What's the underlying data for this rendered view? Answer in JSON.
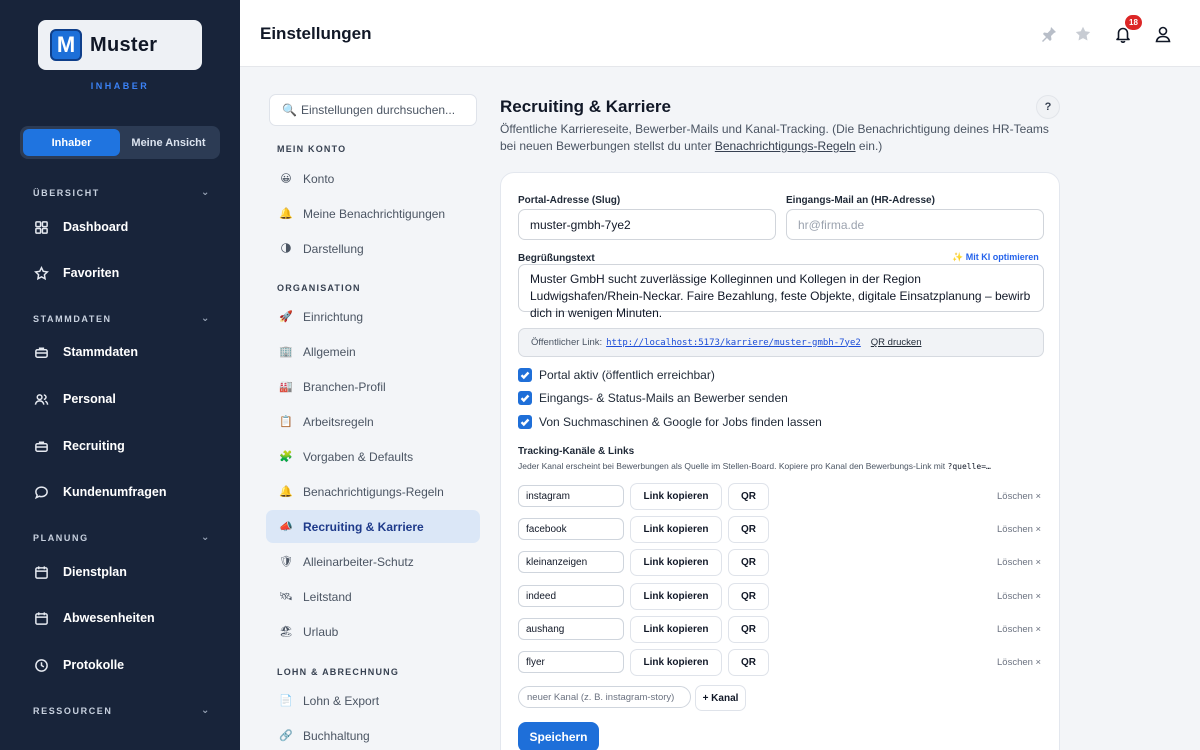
{
  "brand": {
    "logo_letter": "M",
    "name": "Muster",
    "role": "INHABER"
  },
  "view_toggle": {
    "owner": "Inhaber",
    "my_view": "Meine Ansicht"
  },
  "sidebar": {
    "sections": [
      {
        "title": "ÜBERSICHT",
        "items": [
          {
            "label": "Dashboard",
            "icon": "grid-icon"
          },
          {
            "label": "Favoriten",
            "icon": "star-icon"
          }
        ]
      },
      {
        "title": "STAMMDATEN",
        "items": [
          {
            "label": "Stammdaten",
            "icon": "briefcase-icon"
          },
          {
            "label": "Personal",
            "icon": "users-icon"
          },
          {
            "label": "Recruiting",
            "icon": "briefcase-icon"
          },
          {
            "label": "Kundenumfragen",
            "icon": "chat-icon"
          }
        ]
      },
      {
        "title": "PLANUNG",
        "items": [
          {
            "label": "Dienstplan",
            "icon": "calendar-icon"
          },
          {
            "label": "Abwesenheiten",
            "icon": "calendar-icon"
          },
          {
            "label": "Protokolle",
            "icon": "clock-icon"
          }
        ]
      },
      {
        "title": "RESSOURCEN",
        "items": []
      }
    ]
  },
  "header": {
    "title": "Einstellungen",
    "notification_count": "18"
  },
  "settings_nav": {
    "search_placeholder": "Einstellungen durchsuchen...",
    "sections": [
      {
        "title": "MEIN KONTO",
        "items": [
          {
            "label": "Konto",
            "emoji": "😀"
          },
          {
            "label": "Meine Benachrichtigungen",
            "emoji": "🔔"
          },
          {
            "label": "Darstellung",
            "emoji": "🌗"
          }
        ]
      },
      {
        "title": "ORGANISATION",
        "items": [
          {
            "label": "Einrichtung",
            "emoji": "🚀"
          },
          {
            "label": "Allgemein",
            "emoji": "🏢"
          },
          {
            "label": "Branchen-Profil",
            "emoji": "🏭"
          },
          {
            "label": "Arbeitsregeln",
            "emoji": "📋"
          },
          {
            "label": "Vorgaben & Defaults",
            "emoji": "🧩"
          },
          {
            "label": "Benachrichtigungs-Regeln",
            "emoji": "🔔"
          },
          {
            "label": "Recruiting & Karriere",
            "emoji": "📣"
          },
          {
            "label": "Alleinarbeiter-Schutz",
            "emoji": "🛡"
          },
          {
            "label": "Leitstand",
            "emoji": "🛰"
          },
          {
            "label": "Urlaub",
            "emoji": "🏖"
          }
        ]
      },
      {
        "title": "LOHN & ABRECHNUNG",
        "items": [
          {
            "label": "Lohn & Export",
            "emoji": "📄"
          },
          {
            "label": "Buchhaltung",
            "emoji": "🔗"
          }
        ]
      }
    ]
  },
  "content": {
    "title": "Recruiting & Karriere",
    "help": "?",
    "desc_before": "Öffentliche Karriereseite, Bewerber-Mails und Kanal-Tracking. (Die Benachrichtigung deines HR-Teams bei neuen Bewerbungen stellst du unter ",
    "desc_link": "Benachrichtigungs-Regeln",
    "desc_after": " ein.)",
    "slug_label": "Portal-Adresse (Slug)",
    "slug_value": "muster-gmbh-7ye2",
    "mail_label": "Eingangs-Mail an (HR-Adresse)",
    "mail_placeholder": "hr@firma.de",
    "greeting_label": "Begrüßungstext",
    "ai_button": "✨ Mit KI optimieren",
    "greeting_value": "Muster GmbH sucht zuverlässige Kolleginnen und Kollegen in der Region Ludwigshafen/Rhein-Neckar. Faire Bezahlung, feste Objekte, digitale Einsatzplanung – bewirb dich in wenigen Minuten.",
    "public_link_label": "Öffentlicher Link:",
    "public_link_url": "http://localhost:5173/karriere/muster-gmbh-7ye2",
    "qr_print": "QR drucken",
    "checkboxes": [
      "Portal aktiv (öffentlich erreichbar)",
      "Eingangs- & Status-Mails an Bewerber senden",
      "Von Suchmaschinen & Google for Jobs finden lassen"
    ],
    "tracking_title": "Tracking-Kanäle & Links",
    "tracking_desc": "Jeder Kanal erscheint bei Bewerbungen als Quelle im Stellen-Board. Kopiere pro Kanal den Bewerbungs-Link mit ",
    "tracking_code": "?quelle=…",
    "channels": [
      "instagram",
      "facebook",
      "kleinanzeigen",
      "indeed",
      "aushang",
      "flyer"
    ],
    "copy_label": "Link kopieren",
    "qr_label": "QR",
    "delete_label": "Löschen ×",
    "new_channel_placeholder": "neuer Kanal (z. B. instagram-story)",
    "add_channel": "+ Kanal",
    "save": "Speichern"
  },
  "colors": {
    "sidebar_bg": "#18243a",
    "accent": "#1f6fd8",
    "badge": "#dc2626"
  }
}
